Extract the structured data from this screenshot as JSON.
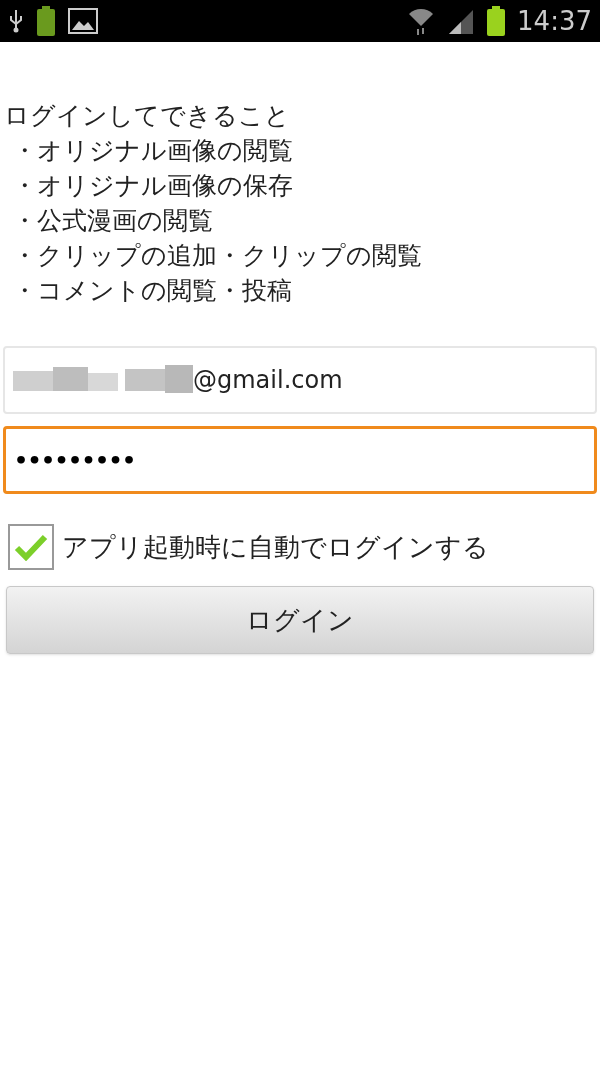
{
  "status_bar": {
    "time": "14:37"
  },
  "intro": {
    "heading": "ログインしてできること",
    "items": [
      "・オリジナル画像の閲覧",
      "・オリジナル画像の保存",
      "・公式漫画の閲覧",
      "・クリップの追加・クリップの閲覧",
      "・コメントの閲覧・投稿"
    ]
  },
  "fields": [
    {
      "kind": "email",
      "value": "@gmail.com",
      "redacted": true,
      "focused": false
    },
    {
      "kind": "password",
      "value": "•••••••••",
      "redacted": false,
      "focused": true
    }
  ],
  "auto_login": {
    "label": "アプリ起動時に自動でログインする",
    "checked": true
  },
  "login_button": {
    "label": "ログイン"
  }
}
